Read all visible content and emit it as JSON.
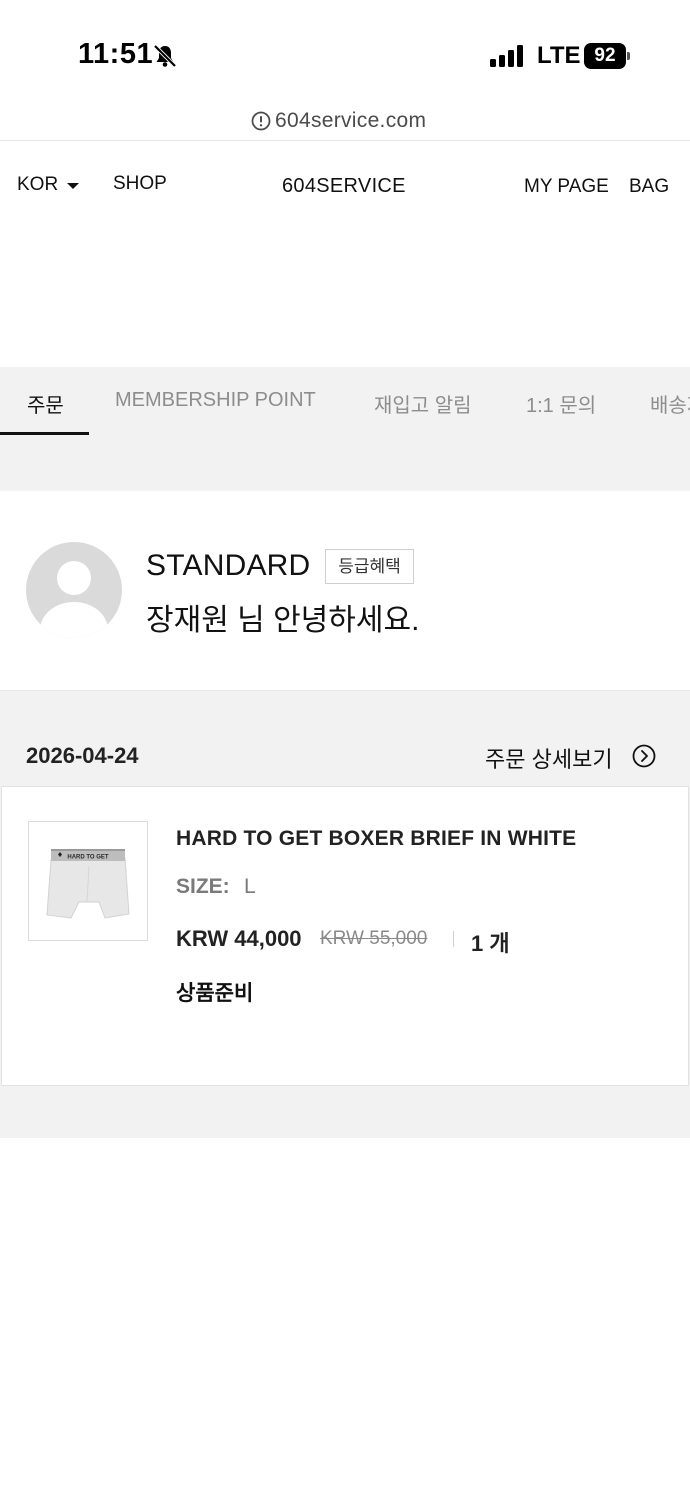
{
  "status_bar": {
    "time": "11:51",
    "network": "LTE",
    "battery": "92"
  },
  "browser": {
    "url": "604service.com"
  },
  "header": {
    "language": "KOR",
    "shop": "SHOP",
    "logo": "604SERVICE",
    "my_page": "MY PAGE",
    "bag": "BAG"
  },
  "tabs": [
    {
      "label": "주문",
      "active": true
    },
    {
      "label": "MEMBERSHIP POINT",
      "active": false
    },
    {
      "label": "재입고 알림",
      "active": false
    },
    {
      "label": "1:1 문의",
      "active": false
    },
    {
      "label": "배송지",
      "active": false
    }
  ],
  "profile": {
    "grade": "STANDARD",
    "grade_benefit": "등급혜택",
    "greeting": "장재원 님 안녕하세요."
  },
  "order": {
    "date": "2026-04-24",
    "detail_link": "주문 상세보기",
    "item": {
      "name": "HARD TO GET BOXER BRIEF IN WHITE",
      "thumb_text": "HARD TO GET",
      "size_label": "SIZE:",
      "size_value": "L",
      "price": "KRW 44,000",
      "original_price": "KRW 55,000",
      "quantity": "1 개",
      "status": "상품준비"
    }
  },
  "colors": {
    "accent": "#111111",
    "tab_background": "#f2f2f2",
    "muted_text": "#8d8d8d"
  }
}
